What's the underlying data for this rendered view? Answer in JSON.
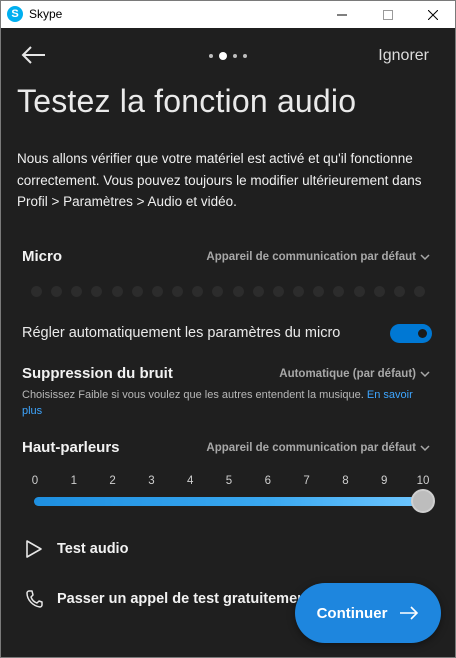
{
  "window": {
    "title": "Skype",
    "app_icon_letter": "S"
  },
  "header": {
    "skip_label": "Ignorer",
    "pager": {
      "count": 4,
      "active": 1
    }
  },
  "page": {
    "title": "Testez la fonction audio",
    "intro": "Nous allons vérifier que votre matériel est activé et qu'il fonctionne correctement. Vous pouvez toujours le modifier ultérieurement dans Profil > Paramètres > Audio et vidéo."
  },
  "micro": {
    "label": "Micro",
    "device": "Appareil de communication par défaut",
    "meter_segments": 20,
    "meter_level": 0
  },
  "auto_adjust": {
    "label": "Régler automatiquement les paramètres du micro",
    "enabled": true
  },
  "noise": {
    "label": "Suppression du bruit",
    "value": "Automatique (par défaut)",
    "help": "Choisissez Faible si vous voulez que les autres entendent la musique.",
    "link": "En savoir plus"
  },
  "speakers": {
    "label": "Haut-parleurs",
    "device": "Appareil de communication par défaut",
    "ticks": [
      "0",
      "1",
      "2",
      "3",
      "4",
      "5",
      "6",
      "7",
      "8",
      "9",
      "10"
    ],
    "volume": 10
  },
  "actions": {
    "test_audio": "Test audio",
    "test_call": "Passer un appel de test gratuitement"
  },
  "continue_label": "Continuer",
  "colors": {
    "background": "#1f1f1f",
    "accent": "#1e86de",
    "link": "#3ea6ff"
  }
}
